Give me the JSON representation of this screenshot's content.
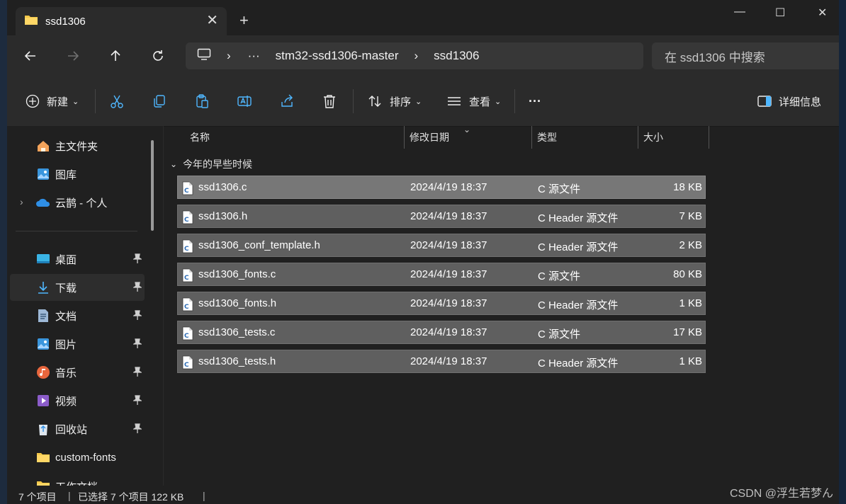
{
  "tab": {
    "title": "ssd1306",
    "close": "✕",
    "new_tab": "+"
  },
  "window_controls": {
    "minimize": "—",
    "maximize": "☐",
    "close": "✕"
  },
  "address": {
    "more": "···",
    "segments": [
      "stm32-ssd1306-master",
      "ssd1306"
    ]
  },
  "search": {
    "placeholder": "在 ssd1306 中搜索"
  },
  "toolbar": {
    "new_label": "新建",
    "sort_label": "排序",
    "view_label": "查看",
    "more_label": "···",
    "details_label": "详细信息"
  },
  "sidebar": {
    "items": [
      {
        "label": "主文件夹",
        "icon": "home-icon"
      },
      {
        "label": "图库",
        "icon": "gallery-icon"
      },
      {
        "label": "云鹊 - 个人",
        "icon": "onedrive-icon"
      },
      {
        "label": "桌面",
        "icon": "desktop-icon"
      },
      {
        "label": "下载",
        "icon": "download-icon"
      },
      {
        "label": "文档",
        "icon": "document-icon"
      },
      {
        "label": "图片",
        "icon": "pictures-icon"
      },
      {
        "label": "音乐",
        "icon": "music-icon"
      },
      {
        "label": "视频",
        "icon": "video-icon"
      },
      {
        "label": "回收站",
        "icon": "recycle-bin-icon"
      },
      {
        "label": "custom-fonts",
        "icon": "folder-icon"
      },
      {
        "label": "工作文档",
        "icon": "folder-icon"
      }
    ]
  },
  "columns": {
    "name": "名称",
    "date": "修改日期",
    "type": "类型",
    "size": "大小"
  },
  "group": {
    "label": "今年的早些时候"
  },
  "files": [
    {
      "name": "ssd1306.c",
      "date": "2024/4/19 18:37",
      "type": "C 源文件",
      "size": "18 KB"
    },
    {
      "name": "ssd1306.h",
      "date": "2024/4/19 18:37",
      "type": "C Header 源文件",
      "size": "7 KB"
    },
    {
      "name": "ssd1306_conf_template.h",
      "date": "2024/4/19 18:37",
      "type": "C Header 源文件",
      "size": "2 KB"
    },
    {
      "name": "ssd1306_fonts.c",
      "date": "2024/4/19 18:37",
      "type": "C 源文件",
      "size": "80 KB"
    },
    {
      "name": "ssd1306_fonts.h",
      "date": "2024/4/19 18:37",
      "type": "C Header 源文件",
      "size": "1 KB"
    },
    {
      "name": "ssd1306_tests.c",
      "date": "2024/4/19 18:37",
      "type": "C 源文件",
      "size": "17 KB"
    },
    {
      "name": "ssd1306_tests.h",
      "date": "2024/4/19 18:37",
      "type": "C Header 源文件",
      "size": "1 KB"
    }
  ],
  "status": {
    "count": "7 个项目",
    "selected": "已选择 7 个项目  122 KB"
  },
  "watermark": "CSDN @浮生若梦ん",
  "colors": {
    "background": "#202020",
    "selected_row": "#5f5f5f",
    "accent": "#60cdff"
  }
}
